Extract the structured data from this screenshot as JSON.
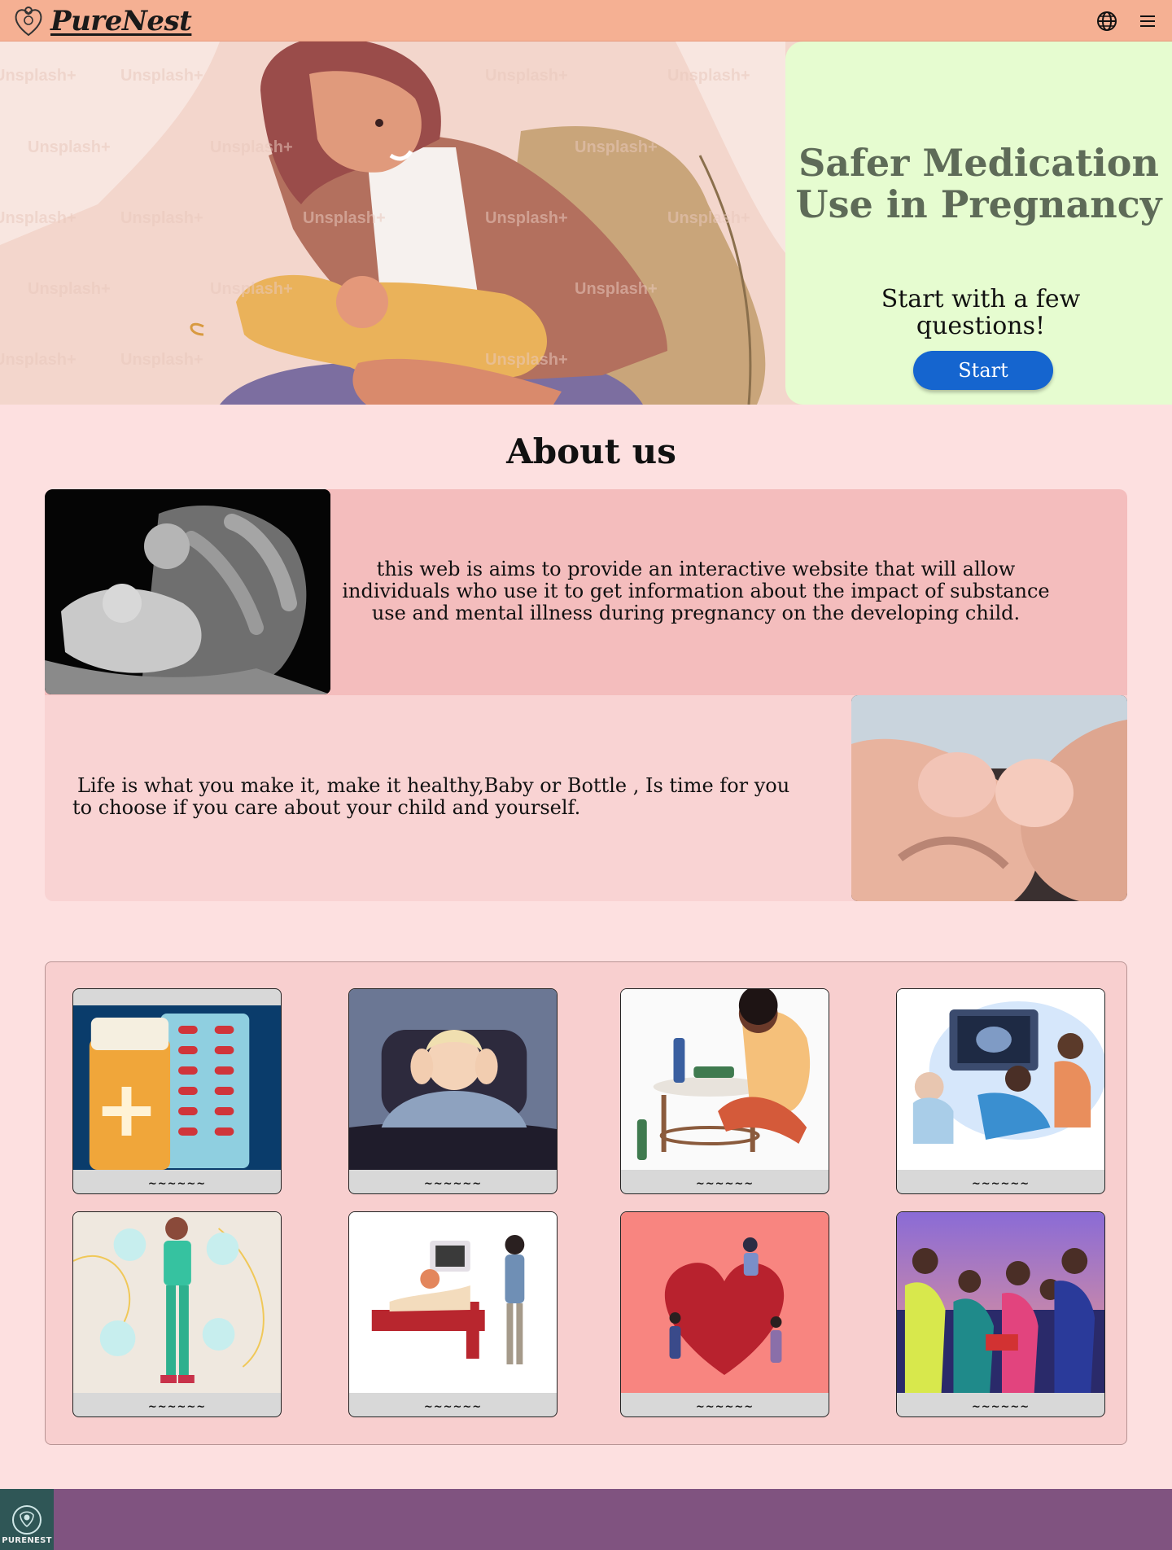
{
  "header": {
    "brand": "PureNest",
    "icons": {
      "language": "globe-icon",
      "menu": "hamburger-menu-icon"
    }
  },
  "hero": {
    "title": "Safer Medication Use in Pregnancy",
    "subtitle": "Start with a few questions!",
    "start_label": "Start",
    "watermark": "Unsplash+"
  },
  "about": {
    "title": "About us",
    "text1": "this web is aims to provide an interactive website that will allow individuals who use it to get information about the impact of substance use and mental illness during pregnancy on the developing child.",
    "text2": "Life is what you make it, make it healthy,Baby or Bottle , Is time for you to choose if you care about your child and yourself."
  },
  "gallery": {
    "tiles": [
      {
        "caption": "~~~~~~",
        "icon": "medication-pills-illustration"
      },
      {
        "caption": "~~~~~~",
        "icon": "stressed-woman-illustration"
      },
      {
        "caption": "~~~~~~",
        "icon": "woman-alcohol-illustration"
      },
      {
        "caption": "~~~~~~",
        "icon": "ultrasound-illustration"
      },
      {
        "caption": "~~~~~~",
        "icon": "doctor-illustration"
      },
      {
        "caption": "~~~~~~",
        "icon": "clinic-ultrasound-illustration"
      },
      {
        "caption": "~~~~~~",
        "icon": "heart-couple-illustration"
      },
      {
        "caption": "~~~~~~",
        "icon": "party-illustration"
      }
    ]
  },
  "footer": {
    "logo_text": "PURENEST"
  },
  "colors": {
    "header": "#f5b093",
    "hero_panel": "#e6fcd0",
    "start_button": "#1565cf",
    "about_row1": "#f4bdbd",
    "about_row2": "#f9d3d3",
    "footer": "#805380",
    "page": "#fde0e0"
  }
}
